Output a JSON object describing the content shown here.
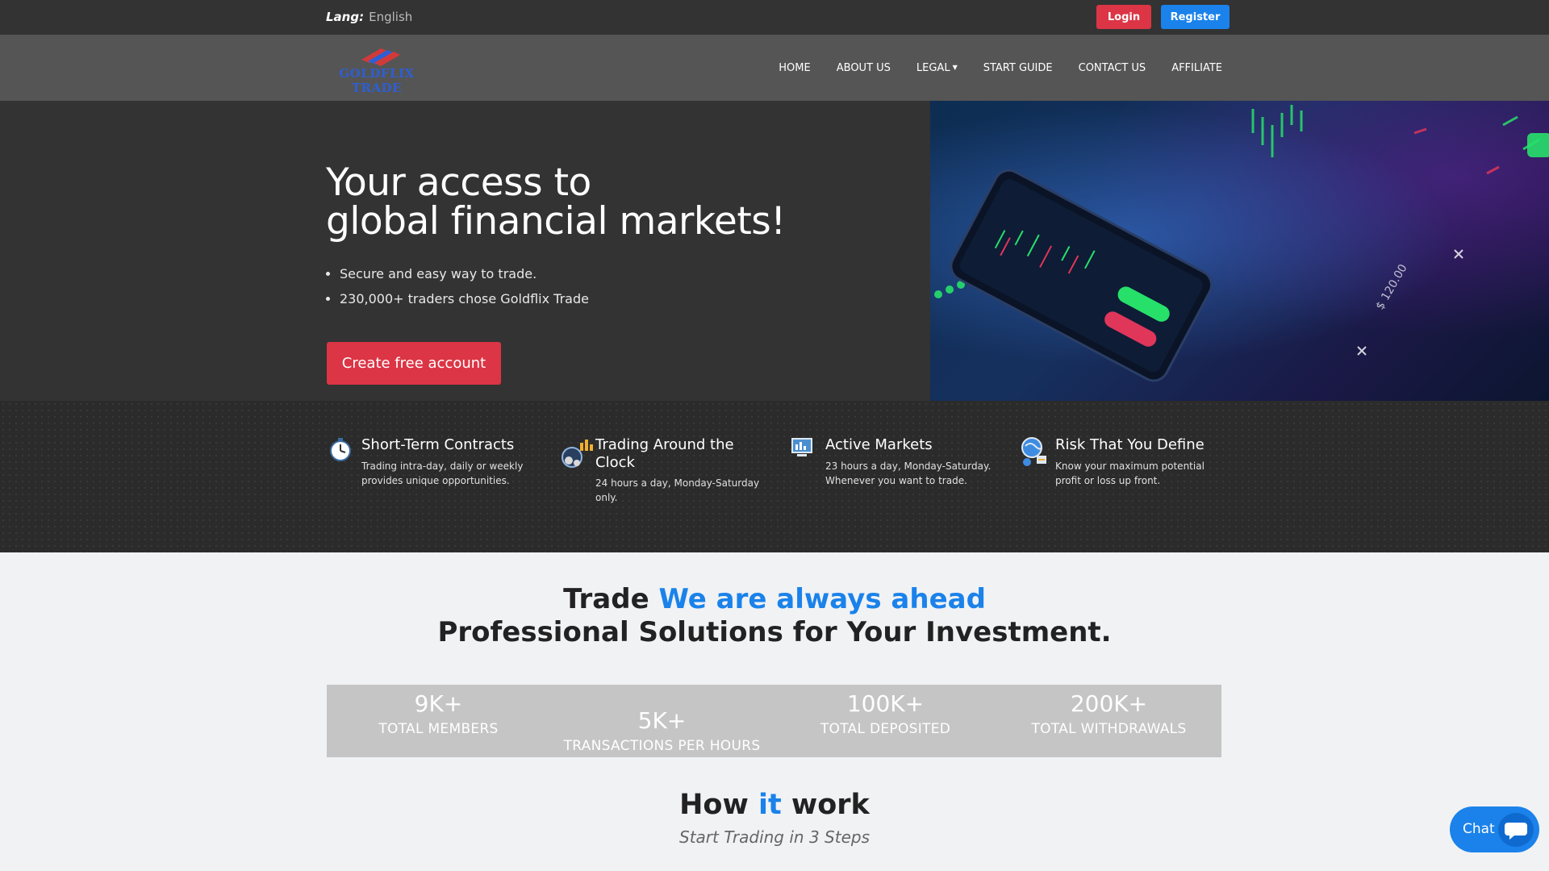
{
  "topbar": {
    "lang_key": "Lang:",
    "lang_value": "English",
    "login_label": "Login",
    "register_label": "Register"
  },
  "brand": {
    "logo_line1": "GOLDFLIX",
    "logo_line2": "TRADE"
  },
  "nav": {
    "items": [
      "HOME",
      "ABOUT US",
      "LEGAL",
      "START GUIDE",
      "CONTACT US",
      "AFFILIATE"
    ]
  },
  "hero": {
    "title_line1": "Your access to",
    "title_line2": "global financial markets!",
    "bullets": [
      "Secure and easy way to trade.",
      "230,000+ traders chose Goldflix Trade"
    ],
    "cta_label": "Create free account"
  },
  "features": [
    {
      "title": "Short-Term Contracts",
      "desc": "Trading intra-day, daily or weekly provides unique opportunities.",
      "icon": "clock-icon"
    },
    {
      "title": "Trading Around the Clock",
      "desc": "24 hours a day, Monday-Saturday only.",
      "icon": "globe-chart-icon"
    },
    {
      "title": "Active Markets",
      "desc": "23 hours a day, Monday-Saturday. Whenever you want to trade.",
      "icon": "market-screen-icon"
    },
    {
      "title": "Risk That You Define",
      "desc": "Know your maximum potential profit or loss up front.",
      "icon": "risk-globe-icon"
    }
  ],
  "intro": {
    "line1_prefix": "Trade",
    "line1_accent": "We are always ahead",
    "line2": "Professional Solutions for Your Investment."
  },
  "stats": [
    {
      "value": "9K+",
      "label": "TOTAL MEMBERS"
    },
    {
      "value": "5K+",
      "label": "TRANSACTIONS PER HOURS"
    },
    {
      "value": "100K+",
      "label": "TOTAL DEPOSITED"
    },
    {
      "value": "200K+",
      "label": "TOTAL WITHDRAWALS"
    }
  ],
  "how": {
    "title_a": "How",
    "title_accent": "it",
    "title_b": "work",
    "subtitle": "Start Trading in 3 Steps"
  },
  "chat": {
    "label": "Chat"
  },
  "colors": {
    "accent_blue": "#1a82ea",
    "accent_red": "#dc3545",
    "dark": "#333333"
  }
}
